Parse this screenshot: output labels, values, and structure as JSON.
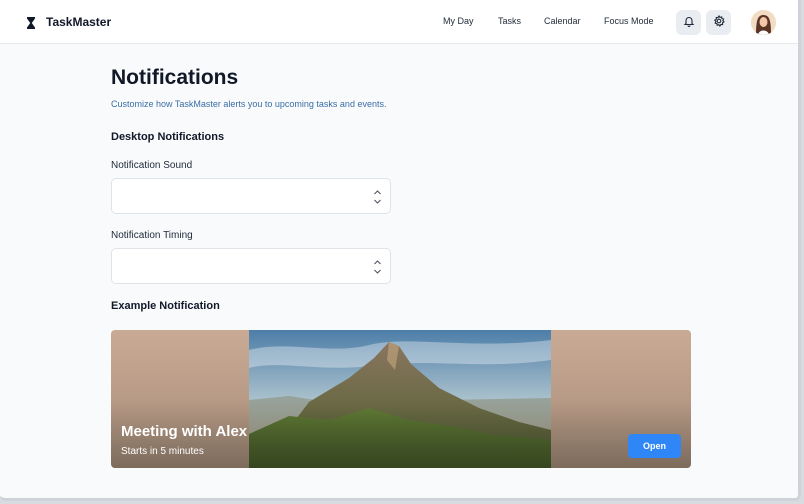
{
  "app": {
    "name": "TaskMaster",
    "logo_icon": "hourglass-icon"
  },
  "nav": {
    "items": [
      "My Day",
      "Tasks",
      "Calendar",
      "Focus Mode"
    ]
  },
  "header_actions": {
    "notifications_icon": "bell-icon",
    "settings_icon": "gear-icon"
  },
  "page": {
    "title": "Notifications",
    "subtitle": "Customize how TaskMaster alerts you to upcoming tasks and events."
  },
  "desktop": {
    "section_title": "Desktop Notifications",
    "sound": {
      "label": "Notification Sound",
      "value": ""
    },
    "timing": {
      "label": "Notification Timing",
      "value": ""
    }
  },
  "example": {
    "section_title": "Example Notification",
    "title": "Meeting with Alex",
    "subtitle": "Starts in 5 minutes",
    "action_label": "Open"
  },
  "colors": {
    "accent": "#2f86f6",
    "link": "#3b6ea5",
    "background": "#f8fafc"
  }
}
